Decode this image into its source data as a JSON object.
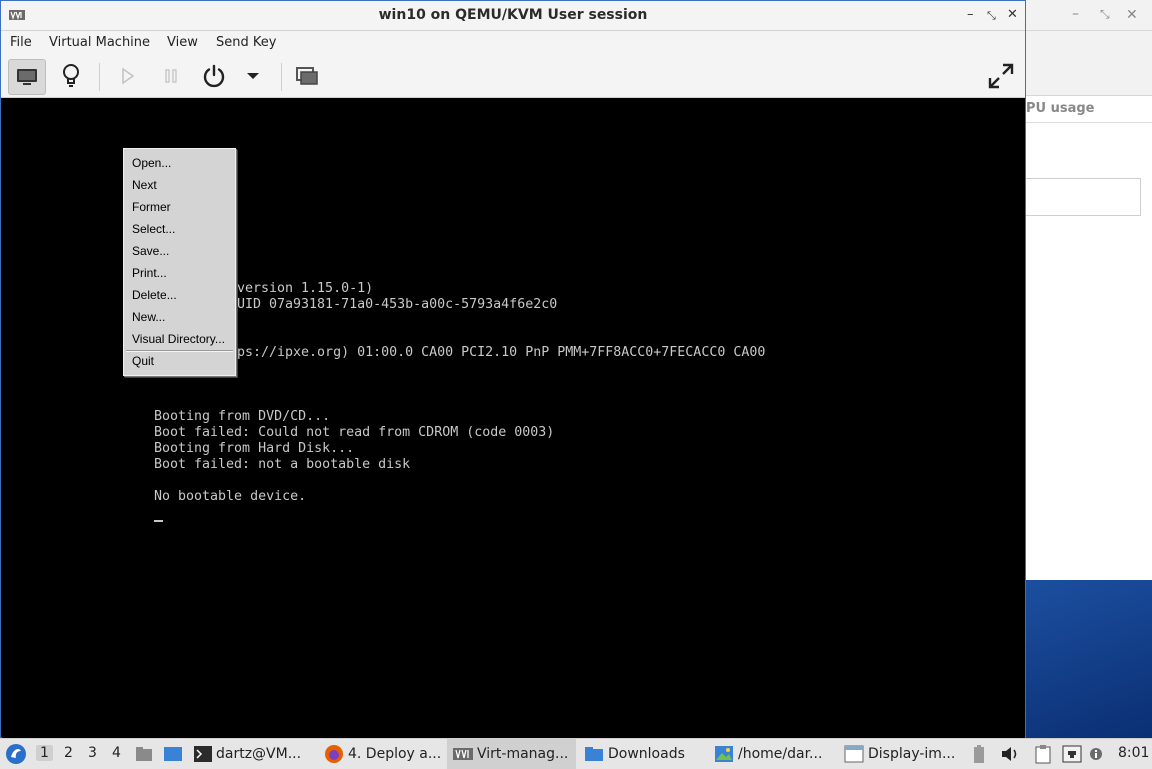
{
  "window": {
    "title": "win10 on QEMU/KVM User session"
  },
  "menubar": {
    "items": [
      "File",
      "Virtual Machine",
      "View",
      "Send Key"
    ]
  },
  "toolbar": {
    "buttons": [
      "display-console",
      "details",
      "run",
      "pause",
      "power",
      "power-menu",
      "snapshots",
      "fullscreen"
    ]
  },
  "background_window": {
    "column_header": "PU usage"
  },
  "console": {
    "lines": [
      "version 1.15.0-1)",
      "UID 07a93181-71a0-453b-a00c-5793a4f6e2c0",
      "ps://ipxe.org) 01:00.0 CA00 PCI2.10 PnP PMM+7FF8ACC0+7FECACC0 CA00",
      "Booting from DVD/CD...",
      "Boot failed: Could not read from CDROM (code 0003)",
      "Booting from Hard Disk...",
      "Boot failed: not a bootable disk",
      "No bootable device."
    ]
  },
  "context_menu": {
    "items": [
      "Open...",
      "Next",
      "Former",
      "Select...",
      "Save...",
      "Print...",
      "Delete...",
      "New...",
      "Visual Directory...",
      "Quit"
    ]
  },
  "taskbar": {
    "workspaces": [
      "1",
      "2",
      "3",
      "4"
    ],
    "tasks": [
      "dartz@VM...",
      "4. Deploy a...",
      "Virt-manag...",
      "Downloads",
      "/home/dar...",
      "Display-im..."
    ],
    "clock": "8:01"
  },
  "colors": {
    "console_bg": "#000000",
    "console_text": "#c8c8c8",
    "desktop_blue": "#0f3b7e",
    "menu_bg": "#d4d4d4"
  }
}
